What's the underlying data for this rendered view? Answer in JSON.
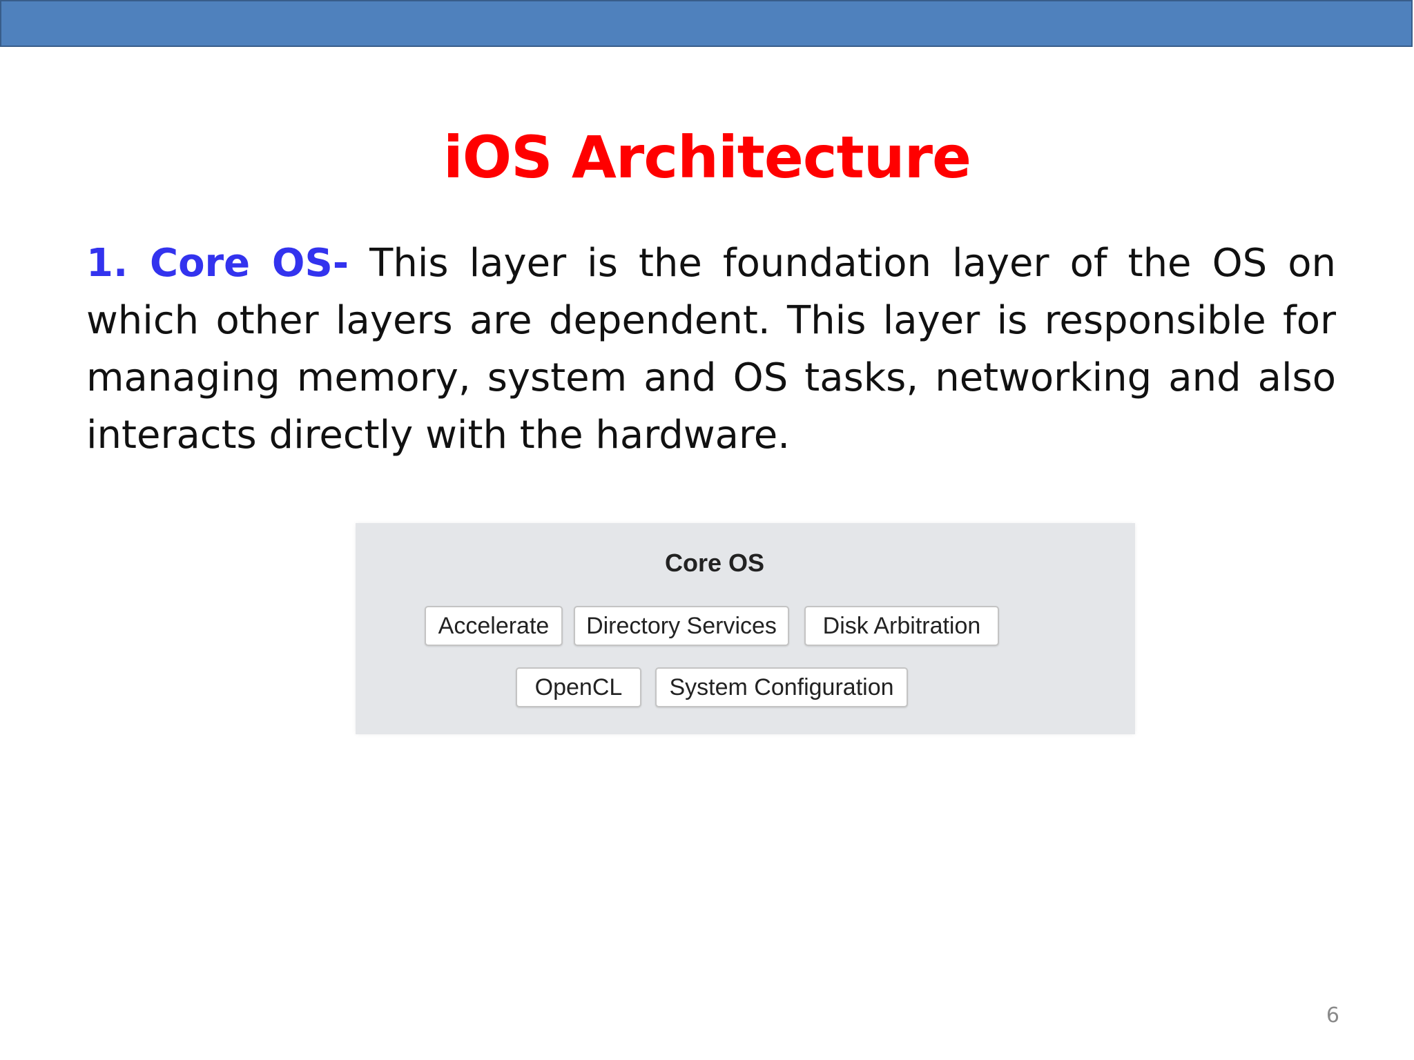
{
  "slide": {
    "title": "iOS Architecture",
    "lead_label": "1. Core OS-",
    "body_text": " This layer is the foundation layer of the OS on which other layers are dependent. This layer is responsible for managing memory, system and OS tasks, networking and also interacts directly with the hardware.",
    "page_number": "6"
  },
  "diagram": {
    "title": "Core OS",
    "row1": [
      "Accelerate",
      "Directory Services",
      "Disk Arbitration"
    ],
    "row2": [
      "OpenCL",
      "System Configuration"
    ]
  },
  "colors": {
    "top_bar": "#4f81bd",
    "title": "#ff0000",
    "lead_label": "#3333ee",
    "diagram_background": "#e4e6e9"
  }
}
